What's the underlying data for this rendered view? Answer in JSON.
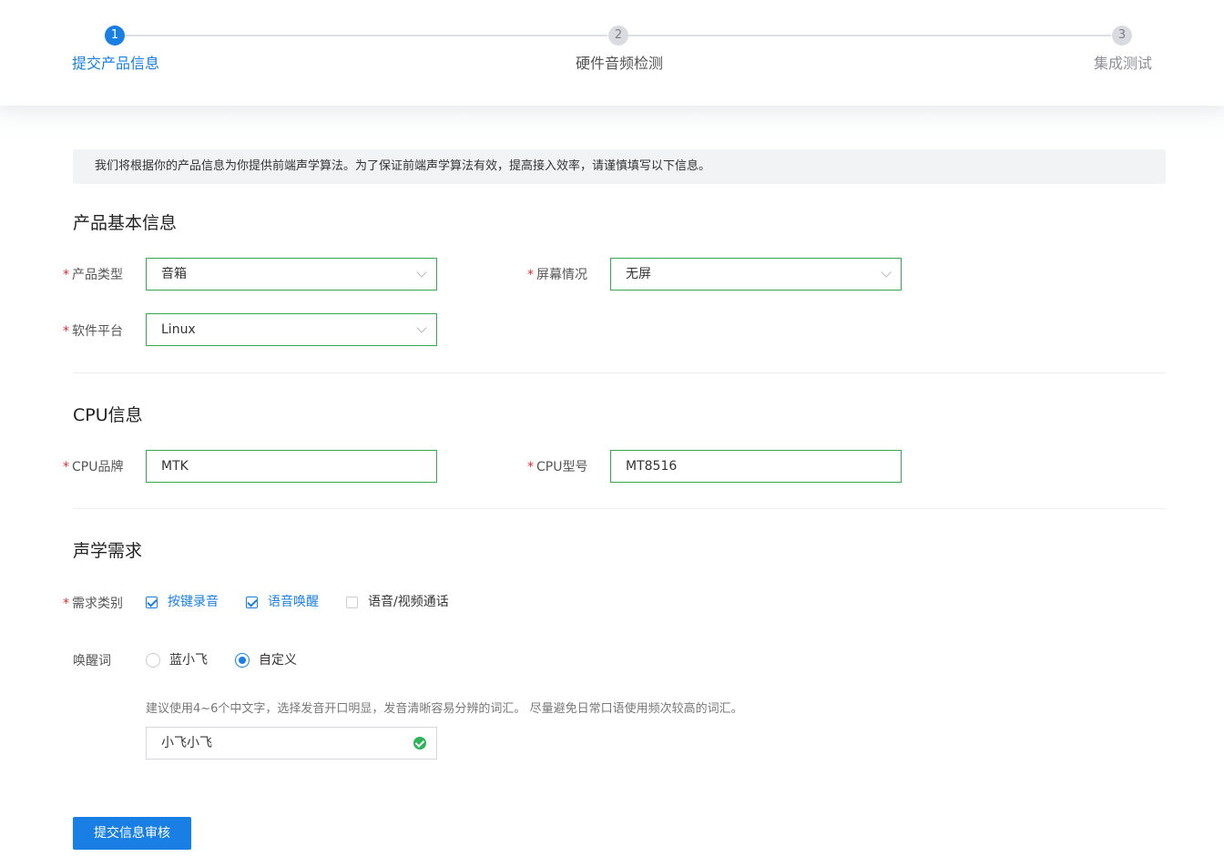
{
  "steps": [
    {
      "number": "1",
      "label": "提交产品信息",
      "state": "active"
    },
    {
      "number": "2",
      "label": "硬件音频检测",
      "state": "pending"
    },
    {
      "number": "3",
      "label": "集成测试",
      "state": "pending"
    }
  ],
  "notice": "我们将根据你的产品信息为你提供前端声学算法。为了保证前端声学算法有效，提高接入效率，请谨慎填写以下信息。",
  "basic_info": {
    "title": "产品基本信息",
    "product_type": {
      "label": "产品类型",
      "value": "音箱"
    },
    "screen": {
      "label": "屏幕情况",
      "value": "无屏"
    },
    "platform": {
      "label": "软件平台",
      "value": "Linux"
    }
  },
  "cpu_info": {
    "title": "CPU信息",
    "brand": {
      "label": "CPU品牌",
      "value": "MTK"
    },
    "model": {
      "label": "CPU型号",
      "value": "MT8516"
    }
  },
  "acoustic": {
    "title": "声学需求",
    "requirement": {
      "label": "需求类别",
      "options": [
        {
          "label": "按键录音",
          "checked": true
        },
        {
          "label": "语音唤醒",
          "checked": true
        },
        {
          "label": "语音/视频通话",
          "checked": false
        }
      ]
    },
    "wake_word": {
      "label": "唤醒词",
      "options": [
        {
          "label": "蓝小飞",
          "checked": false
        },
        {
          "label": "自定义",
          "checked": true
        }
      ],
      "hint": "建议使用4~6个中文字，选择发音开口明显，发音清晰容易分辨的词汇。 尽量避免日常口语使用频次较高的词汇。",
      "value": "小飞小飞"
    }
  },
  "submit_label": "提交信息审核",
  "required_mark": "*",
  "colors": {
    "primary": "#1a7fe4",
    "valid": "#34a853",
    "required": "#e02d2d"
  }
}
